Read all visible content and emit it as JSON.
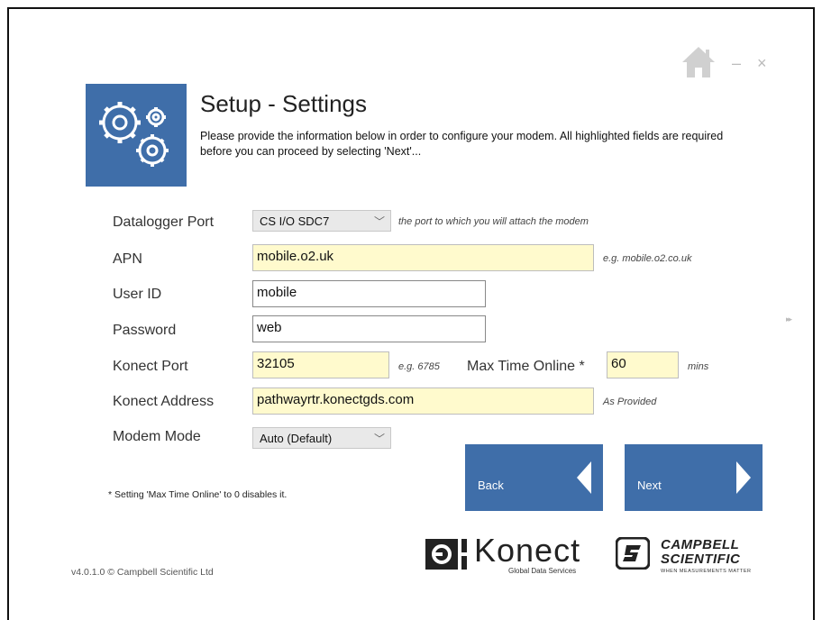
{
  "window": {
    "minimize": "–",
    "close": "×"
  },
  "header": {
    "title": "Setup - Settings",
    "subtitle": "Please provide the information below in order to configure your modem.  All highlighted fields are required before you can proceed by selecting 'Next'..."
  },
  "form": {
    "datalogger_port": {
      "label": "Datalogger Port",
      "value": "CS I/O SDC7",
      "hint": "the port to which you will attach the modem"
    },
    "apn": {
      "label": "APN",
      "value": "mobile.o2.uk",
      "hint": "e.g. mobile.o2.co.uk"
    },
    "user_id": {
      "label": "User ID",
      "value": "mobile"
    },
    "password": {
      "label": "Password",
      "value": "web"
    },
    "konect_port": {
      "label": "Konect Port",
      "value": "32105",
      "hint": "e.g. 6785"
    },
    "max_time_online": {
      "label": "Max Time Online *",
      "value": "60",
      "unit": "mins"
    },
    "konect_address": {
      "label": "Konect Address",
      "value": "pathwayrtr.konectgds.com",
      "hint": "As Provided"
    },
    "modem_mode": {
      "label": "Modem Mode",
      "value": "Auto (Default)"
    }
  },
  "buttons": {
    "back": "Back",
    "next": "Next"
  },
  "note": "* Setting 'Max Time Online' to 0 disables it.",
  "footer": {
    "version": "v4.0.1.0 © Campbell Scientific Ltd",
    "konect_name": "Konect",
    "konect_tagline": "Global Data Services",
    "campbell_line1": "CAMPBELL",
    "campbell_line2": "SCIENTIFIC",
    "campbell_tagline": "WHEN MEASUREMENTS MATTER"
  },
  "colors": {
    "accent": "#3f6ea9",
    "required_field": "#fffacd"
  }
}
